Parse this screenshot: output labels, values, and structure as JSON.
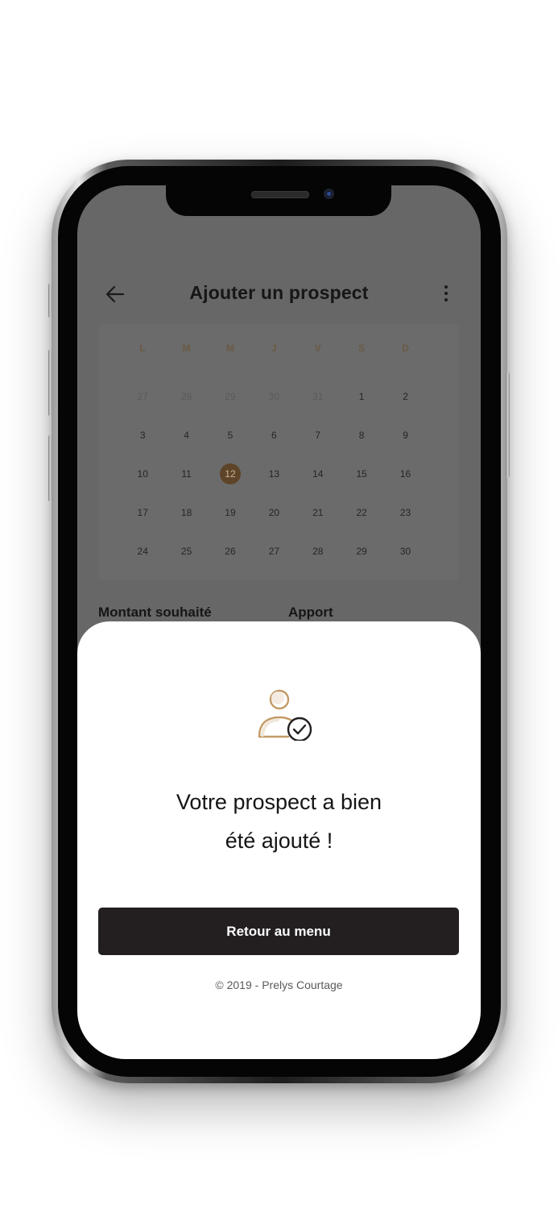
{
  "header": {
    "title": "Ajouter un prospect",
    "back_icon": "arrow-left-icon",
    "menu_icon": "more-vertical-icon"
  },
  "calendar": {
    "weekdays": [
      "L",
      "M",
      "M",
      "J",
      "V",
      "S",
      "D"
    ],
    "weeks": [
      [
        "27",
        "28",
        "29",
        "30",
        "31",
        "1",
        "2"
      ],
      [
        "3",
        "4",
        "5",
        "6",
        "7",
        "8",
        "9"
      ],
      [
        "10",
        "11",
        "12",
        "13",
        "14",
        "15",
        "16"
      ],
      [
        "17",
        "18",
        "19",
        "20",
        "21",
        "22",
        "23"
      ],
      [
        "24",
        "25",
        "26",
        "27",
        "28",
        "29",
        "30"
      ]
    ],
    "selected_day": "12",
    "selected_color": "#b8884f"
  },
  "form": {
    "amount_label": "Montant souhaité",
    "contribution_label": "Apport"
  },
  "modal": {
    "icon": "user-check-icon",
    "message_line1": "Votre prospect a bien",
    "message_line2": "été ajouté !",
    "button_label": "Retour au menu",
    "footer": "© 2019 - Prelys Courtage"
  },
  "colors": {
    "accent": "#c39a66",
    "button_bg": "#231f20",
    "overlay": "#676767"
  }
}
